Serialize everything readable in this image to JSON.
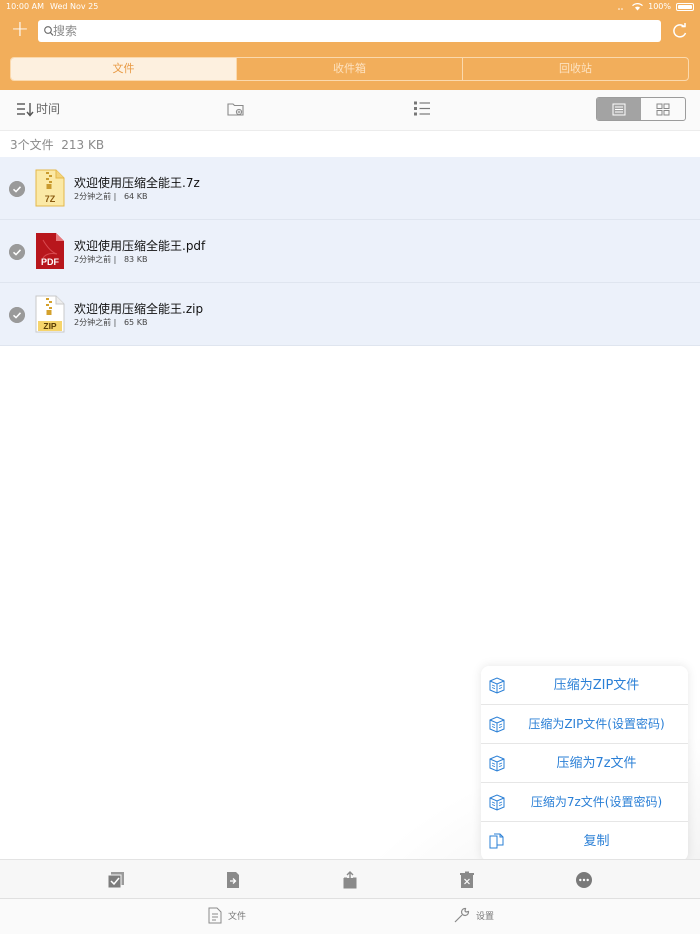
{
  "status": {
    "time": "10:00 AM",
    "date": "Wed Nov 25",
    "battery": "100%"
  },
  "header": {
    "search_placeholder": "搜索",
    "segments": [
      {
        "label": "文件",
        "active": true
      },
      {
        "label": "收件箱",
        "active": false
      },
      {
        "label": "回收站",
        "active": false
      }
    ],
    "accent_color": "#f2ae5b"
  },
  "toolbar": {
    "sort_label": "时间"
  },
  "summary": {
    "count": "3个文件",
    "size": "213 KB"
  },
  "files": [
    {
      "name": "欢迎使用压缩全能王.7z",
      "time": "2分钟之前",
      "size": "64 KB",
      "badge": "7Z",
      "icon": "7z-archive-icon"
    },
    {
      "name": "欢迎使用压缩全能王.pdf",
      "time": "2分钟之前",
      "size": "83 KB",
      "badge": "PDF",
      "icon": "pdf-file-icon"
    },
    {
      "name": "欢迎使用压缩全能王.zip",
      "time": "2分钟之前",
      "size": "65 KB",
      "badge": "ZIP",
      "icon": "zip-archive-icon"
    }
  ],
  "popup_menu": [
    {
      "label": "压缩为ZIP文件",
      "icon": "compress-box-icon"
    },
    {
      "label": "压缩为ZIP文件(设置密码)",
      "icon": "compress-box-icon"
    },
    {
      "label": "压缩为7z文件",
      "icon": "compress-box-icon"
    },
    {
      "label": "压缩为7z文件(设置密码)",
      "icon": "compress-box-icon"
    },
    {
      "label": "复制",
      "icon": "copy-icon"
    }
  ],
  "tabs": [
    {
      "label": "文件",
      "icon": "document-icon"
    },
    {
      "label": "设置",
      "icon": "wrench-icon"
    }
  ]
}
